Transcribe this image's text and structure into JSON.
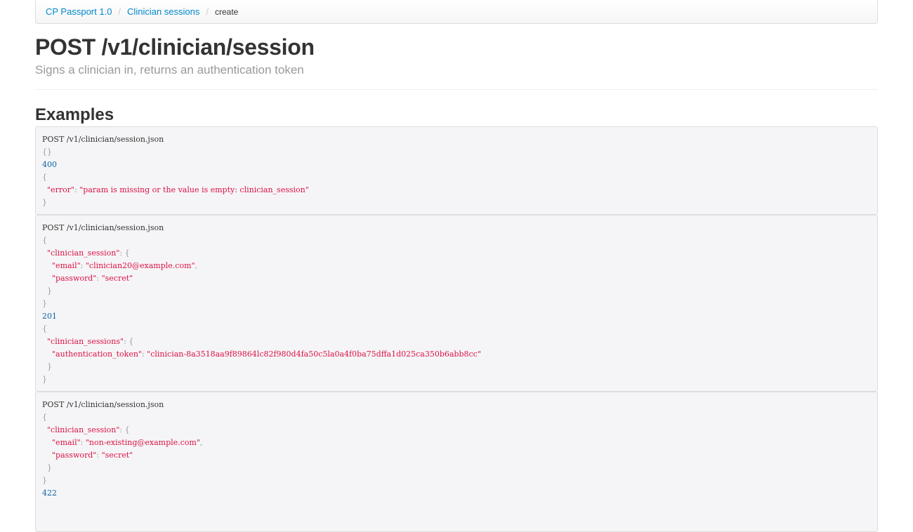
{
  "breadcrumb": {
    "items": [
      "CP Passport 1.0",
      "Clinician sessions"
    ],
    "separator": "/",
    "active": "create"
  },
  "header": {
    "title": "POST /v1/clinician/session",
    "subtitle": "Signs a clinician in, returns an authentication token"
  },
  "examples_heading": "Examples",
  "examples": [
    {
      "request_line": "POST /v1/clinician/session.json",
      "request_body": "{}",
      "status": "400",
      "response": {
        "error_key": "\"error\"",
        "error_value": "\"param is missing or the value is empty: clinician_session\""
      }
    },
    {
      "request_line": "POST /v1/clinician/session.json",
      "session_key": "\"clinician_session\"",
      "email_key": "\"email\"",
      "email_value": "\"clinician20@example.com\"",
      "password_key": "\"password\"",
      "password_value": "\"secret\"",
      "status": "201",
      "response": {
        "sessions_key": "\"clinician_sessions\"",
        "token_key": "\"authentication_token\"",
        "token_value": "\"clinician-8a3518aa9f89864lc82f980d4fa50c5la0a4f0ba75dffa1d025ca350b6abb8cc\""
      }
    },
    {
      "request_line": "POST /v1/clinician/session.json",
      "session_key": "\"clinician_session\"",
      "email_key": "\"email\"",
      "email_value": "\"non-existing@example.com\"",
      "password_key": "\"password\"",
      "password_value": "\"secret\"",
      "status": "422"
    }
  ],
  "colors": {
    "link": "#0088cc",
    "string": "#dd1144",
    "status": "#0e63a3",
    "punctuation": "#999999",
    "code_bg": "#f5f5f7"
  }
}
